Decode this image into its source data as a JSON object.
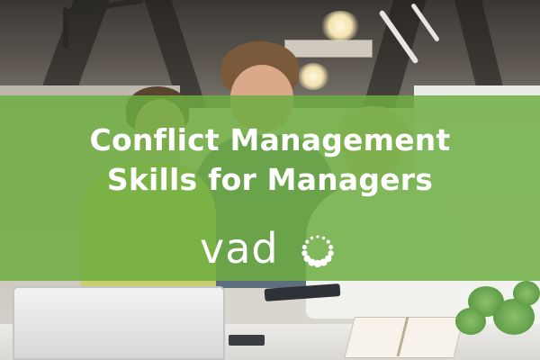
{
  "banner": {
    "title_line1": "Conflict Management",
    "title_line2": "Skills for Managers"
  },
  "brand": {
    "logo_text": "vad",
    "logo_mark": "vado-dotted-o"
  },
  "colors": {
    "band_green": "#6cad3f",
    "text": "#ffffff"
  }
}
